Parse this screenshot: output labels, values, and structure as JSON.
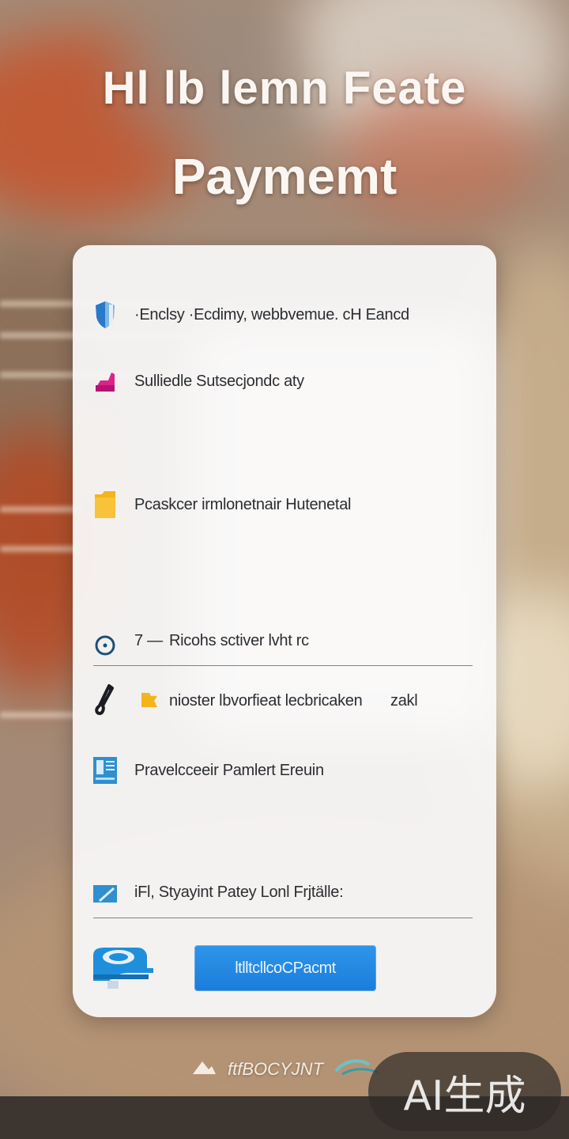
{
  "header": {
    "title": "Hl lb lemn Feate",
    "subtitle": "Paymemt"
  },
  "features": [
    {
      "label": "·Enclsy ·Ecdimy, webbvemue. cH Eancd",
      "icon": "shield-icon",
      "color": "#2a78c8"
    },
    {
      "label": "Sulliedle Sutsecjondc aty",
      "icon": "tag-icon",
      "color": "#e0218a"
    },
    {
      "label": "Pcaskcer irmlonetnair Hutenetal",
      "icon": "folder-icon",
      "color": "#f4b41a"
    },
    {
      "label": "Ricohs sctiver lvht rc",
      "prefix": "7 —",
      "icon": "clock-icon",
      "color": "#1d4f7a"
    },
    {
      "label": "nioster lbvorfieat lecbricaken",
      "suffix": "zakl",
      "icon": "key-icon",
      "color": "#1b1d22",
      "secondary_icon": "folder-tag-icon",
      "secondary_color": "#f4b41a"
    },
    {
      "label": "Pravelcceeir Pamlert Ereuin",
      "icon": "document-icon",
      "color": "#2f8fd0"
    },
    {
      "label": "iFl, Styayint Patey Lonl Frjtälle:",
      "icon": "card-icon",
      "color": "#2f8fd0"
    }
  ],
  "actions": {
    "pay_button_label": "ltlltcllcoCPacmt",
    "wallet_icon": "wallet-icon"
  },
  "footer": {
    "brand": "ftfBOCYJNT",
    "logo_icon": "swoosh-icon"
  },
  "watermark": "AI生成",
  "colors": {
    "accent": "#1f85e0",
    "card": "#f6f5f4"
  }
}
